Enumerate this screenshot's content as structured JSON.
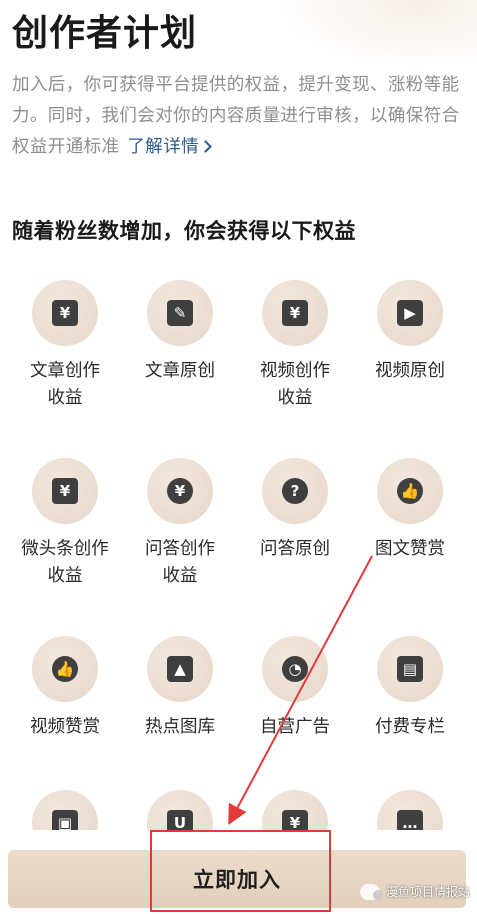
{
  "header": {
    "title": "创作者计划",
    "description": "加入后，你可获得平台提供的权益，提升变现、涨粉等能力。同时，我们会对你的内容质量进行审核，以确保符合权益开通标准",
    "link_label": "了解详情"
  },
  "section": {
    "title": "随着粉丝数增加，你会获得以下权益"
  },
  "benefits": [
    {
      "label": "文章创作\n收益",
      "icon": "yuan-document-icon",
      "glyph": "¥"
    },
    {
      "label": "文章原创",
      "icon": "pen-icon",
      "glyph": "✎"
    },
    {
      "label": "视频创作\n收益",
      "icon": "tv-yuan-icon",
      "glyph": "¥"
    },
    {
      "label": "视频原创",
      "icon": "video-camera-icon",
      "glyph": "▶"
    },
    {
      "label": "微头条创作\n收益",
      "icon": "yuan-document-icon",
      "glyph": "¥"
    },
    {
      "label": "问答创作\n收益",
      "icon": "yuan-coin-icon",
      "glyph": "¥"
    },
    {
      "label": "问答原创",
      "icon": "question-icon",
      "glyph": "?"
    },
    {
      "label": "图文赞赏",
      "icon": "thumbs-up-icon",
      "glyph": "👍"
    },
    {
      "label": "视频赞赏",
      "icon": "thumbs-up-icon",
      "glyph": "👍"
    },
    {
      "label": "热点图库",
      "icon": "image-icon",
      "glyph": "▲"
    },
    {
      "label": "自营广告",
      "icon": "gauge-icon",
      "glyph": "◔"
    },
    {
      "label": "付费专栏",
      "icon": "book-icon",
      "glyph": "▤"
    },
    {
      "label": "",
      "icon": "gift-icon",
      "glyph": "▣"
    },
    {
      "label": "",
      "icon": "bag-icon",
      "glyph": "U"
    },
    {
      "label": "",
      "icon": "video-yuan-icon",
      "glyph": "¥"
    },
    {
      "label": "",
      "icon": "more-icon",
      "glyph": "…"
    }
  ],
  "join_button": {
    "label": "立即加入"
  },
  "watermark": {
    "text": "漫鱼项目情报站"
  },
  "colors": {
    "accent_link": "#2e5a8a",
    "button_bg": "#e6d4c2",
    "icon_bg": "#ecdfd3",
    "annotation_red": "#e23a3a"
  }
}
